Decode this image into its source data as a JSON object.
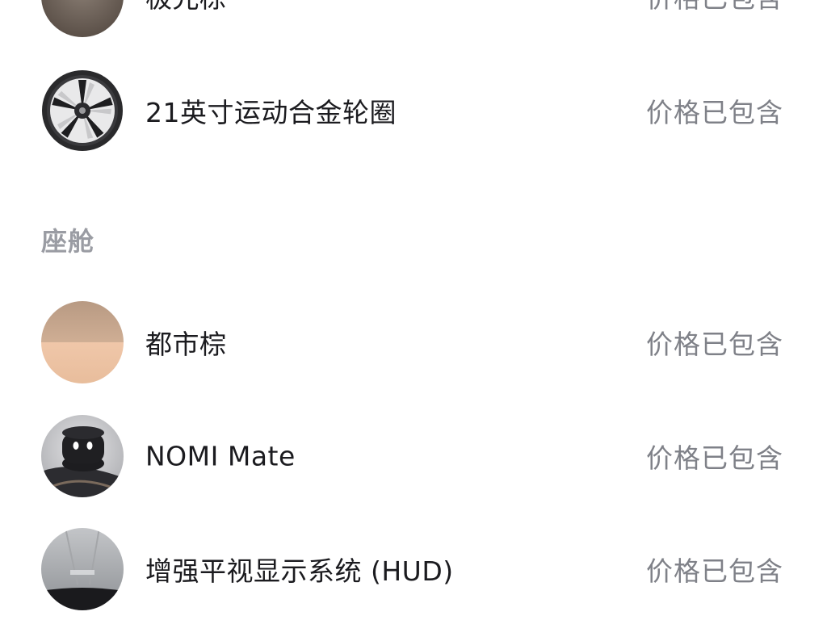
{
  "colors": {
    "item_text": "#1b1b1f",
    "status_text": "#7f8188",
    "section_text": "#9a9ca3",
    "background": "#ffffff"
  },
  "exterior_items": [
    {
      "name": "极光棕",
      "status": "价格已包含",
      "icon": "aurora-brown-swatch-icon"
    },
    {
      "name": "21英寸运动合金轮圈",
      "status": "价格已包含",
      "icon": "alloy-wheel-icon"
    }
  ],
  "cabin": {
    "section_title": "座舱",
    "items": [
      {
        "name": "都市棕",
        "status": "价格已包含",
        "icon": "urban-brown-swatch-icon"
      },
      {
        "name": "NOMI Mate",
        "status": "价格已包含",
        "icon": "nomi-mate-icon"
      },
      {
        "name": "增强平视显示系统 (HUD)",
        "status": "价格已包含",
        "icon": "hud-icon"
      }
    ]
  }
}
